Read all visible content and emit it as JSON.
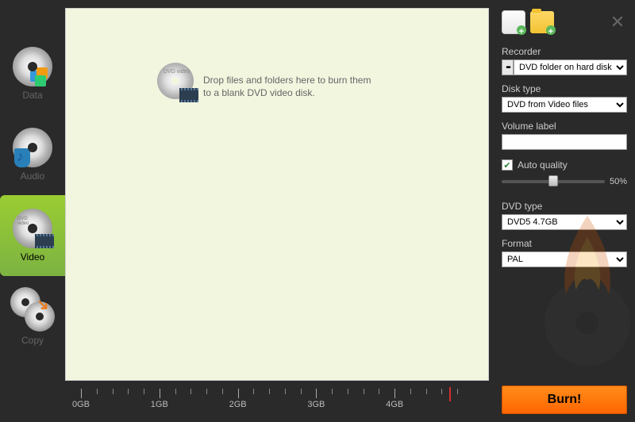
{
  "sidebar": {
    "items": [
      {
        "label": "Data"
      },
      {
        "label": "Audio"
      },
      {
        "label": "Video"
      },
      {
        "label": "Copy"
      }
    ],
    "active_index": 2
  },
  "drop_hint": {
    "line1": "Drop files and folders here to burn them",
    "line2": "to a blank DVD video disk.",
    "disc_badge": "DVD video"
  },
  "ruler": {
    "ticks": [
      "0GB",
      "1GB",
      "2GB",
      "3GB",
      "4GB"
    ],
    "marker_gb": 4.7,
    "max_gb": 5.0
  },
  "panel": {
    "recorder": {
      "label": "Recorder",
      "value": "DVD folder on hard disk"
    },
    "disk_type": {
      "label": "Disk type",
      "value": "DVD from Video files"
    },
    "volume_label": {
      "label": "Volume label",
      "value": ""
    },
    "auto_quality": {
      "label": "Auto quality",
      "checked": true
    },
    "quality_slider": {
      "value_pct": 50,
      "value_text": "50%"
    },
    "dvd_type": {
      "label": "DVD type",
      "value": "DVD5 4.7GB"
    },
    "format": {
      "label": "Format",
      "value": "PAL"
    }
  },
  "burn_button": "Burn!"
}
